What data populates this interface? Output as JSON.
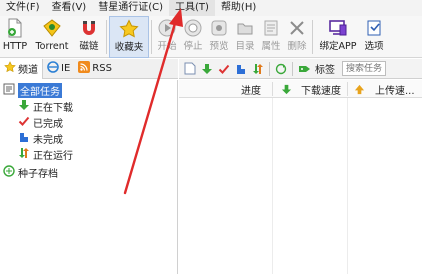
{
  "menu": {
    "file": "文件(F)",
    "view": "查看(V)",
    "comet": "彗星通行证(C)",
    "tools": "工具(T)",
    "help": "帮助(H)"
  },
  "toolbar": {
    "http": "HTTP",
    "torrent": "Torrent",
    "magnet": "磁链",
    "favorites": "收藏夹",
    "start": "开始",
    "stop": "停止",
    "preview": "预览",
    "directory": "目录",
    "properties": "属性",
    "delete": "删除",
    "bind_app": "绑定APP",
    "options": "选项"
  },
  "sidebar": {
    "tabs": [
      "频道",
      "IE",
      "RSS"
    ],
    "tree": {
      "all": "全部任务",
      "downloading": "正在下载",
      "completed": "已完成",
      "incomplete": "未完成",
      "running": "正在运行",
      "seed_archive": "种子存档"
    }
  },
  "task_toolbar": {
    "tags_label": "标签",
    "search_placeholder": "搜索任务"
  },
  "table": {
    "columns": [
      "进度",
      "下载速度",
      "上传速..."
    ]
  },
  "colors": {
    "annotation_arrow": "#e02b2b",
    "selection": "#3b7ad6"
  }
}
